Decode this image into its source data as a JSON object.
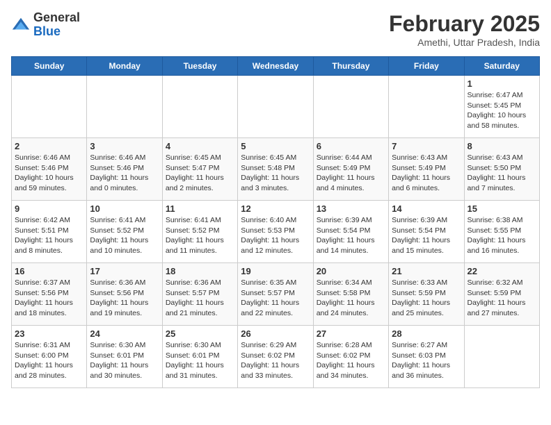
{
  "logo": {
    "general": "General",
    "blue": "Blue"
  },
  "header": {
    "month": "February 2025",
    "location": "Amethi, Uttar Pradesh, India"
  },
  "weekdays": [
    "Sunday",
    "Monday",
    "Tuesday",
    "Wednesday",
    "Thursday",
    "Friday",
    "Saturday"
  ],
  "weeks": [
    [
      {
        "day": null
      },
      {
        "day": null
      },
      {
        "day": null
      },
      {
        "day": null
      },
      {
        "day": null
      },
      {
        "day": null
      },
      {
        "day": 1,
        "sunrise": "6:47 AM",
        "sunset": "5:45 PM",
        "daylight": "10 hours and 58 minutes."
      }
    ],
    [
      {
        "day": 2,
        "sunrise": "6:46 AM",
        "sunset": "5:46 PM",
        "daylight": "10 hours and 59 minutes."
      },
      {
        "day": 3,
        "sunrise": "6:46 AM",
        "sunset": "5:46 PM",
        "daylight": "11 hours and 0 minutes."
      },
      {
        "day": 4,
        "sunrise": "6:45 AM",
        "sunset": "5:47 PM",
        "daylight": "11 hours and 2 minutes."
      },
      {
        "day": 5,
        "sunrise": "6:45 AM",
        "sunset": "5:48 PM",
        "daylight": "11 hours and 3 minutes."
      },
      {
        "day": 6,
        "sunrise": "6:44 AM",
        "sunset": "5:49 PM",
        "daylight": "11 hours and 4 minutes."
      },
      {
        "day": 7,
        "sunrise": "6:43 AM",
        "sunset": "5:49 PM",
        "daylight": "11 hours and 6 minutes."
      },
      {
        "day": 8,
        "sunrise": "6:43 AM",
        "sunset": "5:50 PM",
        "daylight": "11 hours and 7 minutes."
      }
    ],
    [
      {
        "day": 9,
        "sunrise": "6:42 AM",
        "sunset": "5:51 PM",
        "daylight": "11 hours and 8 minutes."
      },
      {
        "day": 10,
        "sunrise": "6:41 AM",
        "sunset": "5:52 PM",
        "daylight": "11 hours and 10 minutes."
      },
      {
        "day": 11,
        "sunrise": "6:41 AM",
        "sunset": "5:52 PM",
        "daylight": "11 hours and 11 minutes."
      },
      {
        "day": 12,
        "sunrise": "6:40 AM",
        "sunset": "5:53 PM",
        "daylight": "11 hours and 12 minutes."
      },
      {
        "day": 13,
        "sunrise": "6:39 AM",
        "sunset": "5:54 PM",
        "daylight": "11 hours and 14 minutes."
      },
      {
        "day": 14,
        "sunrise": "6:39 AM",
        "sunset": "5:54 PM",
        "daylight": "11 hours and 15 minutes."
      },
      {
        "day": 15,
        "sunrise": "6:38 AM",
        "sunset": "5:55 PM",
        "daylight": "11 hours and 16 minutes."
      }
    ],
    [
      {
        "day": 16,
        "sunrise": "6:37 AM",
        "sunset": "5:56 PM",
        "daylight": "11 hours and 18 minutes."
      },
      {
        "day": 17,
        "sunrise": "6:36 AM",
        "sunset": "5:56 PM",
        "daylight": "11 hours and 19 minutes."
      },
      {
        "day": 18,
        "sunrise": "6:36 AM",
        "sunset": "5:57 PM",
        "daylight": "11 hours and 21 minutes."
      },
      {
        "day": 19,
        "sunrise": "6:35 AM",
        "sunset": "5:57 PM",
        "daylight": "11 hours and 22 minutes."
      },
      {
        "day": 20,
        "sunrise": "6:34 AM",
        "sunset": "5:58 PM",
        "daylight": "11 hours and 24 minutes."
      },
      {
        "day": 21,
        "sunrise": "6:33 AM",
        "sunset": "5:59 PM",
        "daylight": "11 hours and 25 minutes."
      },
      {
        "day": 22,
        "sunrise": "6:32 AM",
        "sunset": "5:59 PM",
        "daylight": "11 hours and 27 minutes."
      }
    ],
    [
      {
        "day": 23,
        "sunrise": "6:31 AM",
        "sunset": "6:00 PM",
        "daylight": "11 hours and 28 minutes."
      },
      {
        "day": 24,
        "sunrise": "6:30 AM",
        "sunset": "6:01 PM",
        "daylight": "11 hours and 30 minutes."
      },
      {
        "day": 25,
        "sunrise": "6:30 AM",
        "sunset": "6:01 PM",
        "daylight": "11 hours and 31 minutes."
      },
      {
        "day": 26,
        "sunrise": "6:29 AM",
        "sunset": "6:02 PM",
        "daylight": "11 hours and 33 minutes."
      },
      {
        "day": 27,
        "sunrise": "6:28 AM",
        "sunset": "6:02 PM",
        "daylight": "11 hours and 34 minutes."
      },
      {
        "day": 28,
        "sunrise": "6:27 AM",
        "sunset": "6:03 PM",
        "daylight": "11 hours and 36 minutes."
      },
      {
        "day": null
      }
    ]
  ]
}
